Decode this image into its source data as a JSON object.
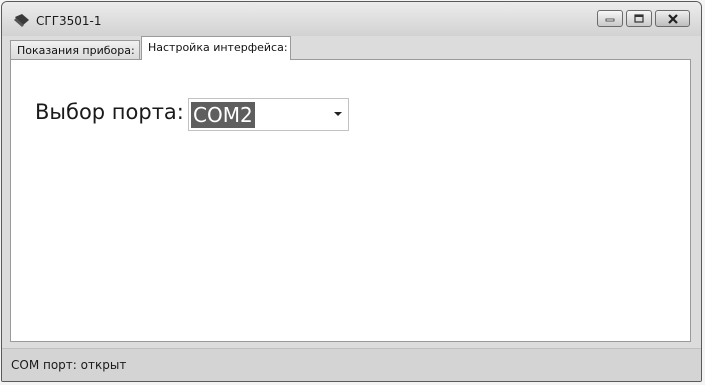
{
  "window": {
    "title": "СГГ3501-1",
    "icons": {
      "app": "app-icon",
      "minimize": "minimize-icon",
      "maximize": "maximize-icon",
      "close": "close-icon"
    }
  },
  "tabs": [
    {
      "label": "Показания прибора:"
    },
    {
      "label": "Настройка интерфейса:",
      "active": true
    }
  ],
  "panel": {
    "port_label": "Выбор порта:",
    "port_select": {
      "value": "COM2"
    }
  },
  "status": {
    "text": "COM порт: открыт"
  }
}
